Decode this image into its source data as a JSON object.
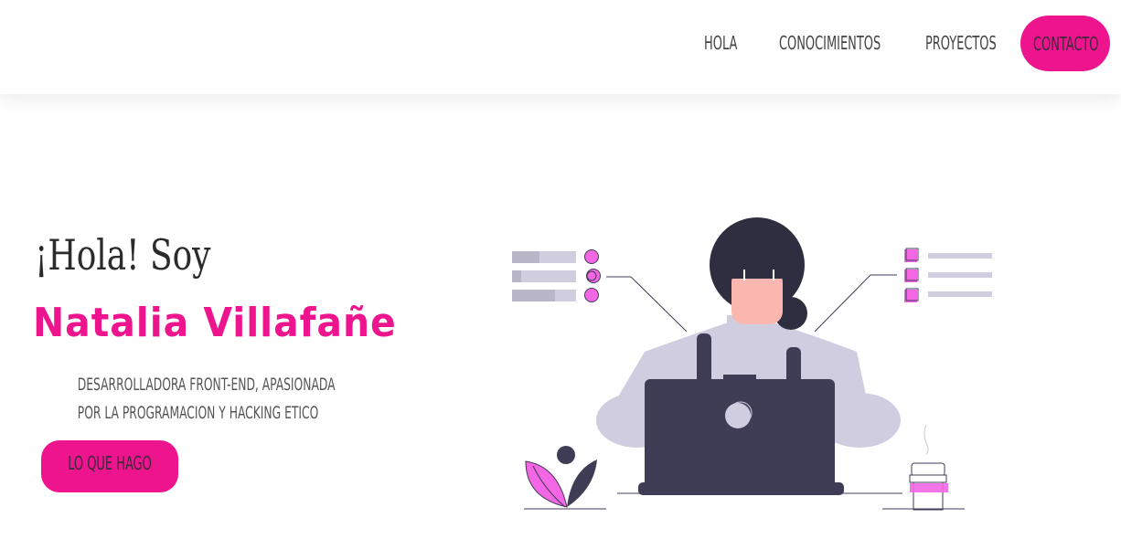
{
  "nav": {
    "items": [
      {
        "label": "HOLA"
      },
      {
        "label": "CONOCIMIENTOS"
      },
      {
        "label": "PROYECTOS"
      }
    ],
    "cta_label": "CONTACTO"
  },
  "hero": {
    "greeting": "¡Hola! Soy",
    "name": "Natalia Villafañe",
    "description_lines": [
      "DESARROLLADORA FRONT-END, APASIONADA",
      "POR LA PROGRAMACION Y HACKING ETICO"
    ],
    "button_label": "LO QUE HAGO"
  },
  "colors": {
    "accent": "#ee148e",
    "illustration_dark": "#3f3d56",
    "illustration_light": "#d0cde1",
    "illustration_pink": "#f366e4"
  },
  "illustration": {
    "icon": "woman-with-laptop-illustration"
  }
}
